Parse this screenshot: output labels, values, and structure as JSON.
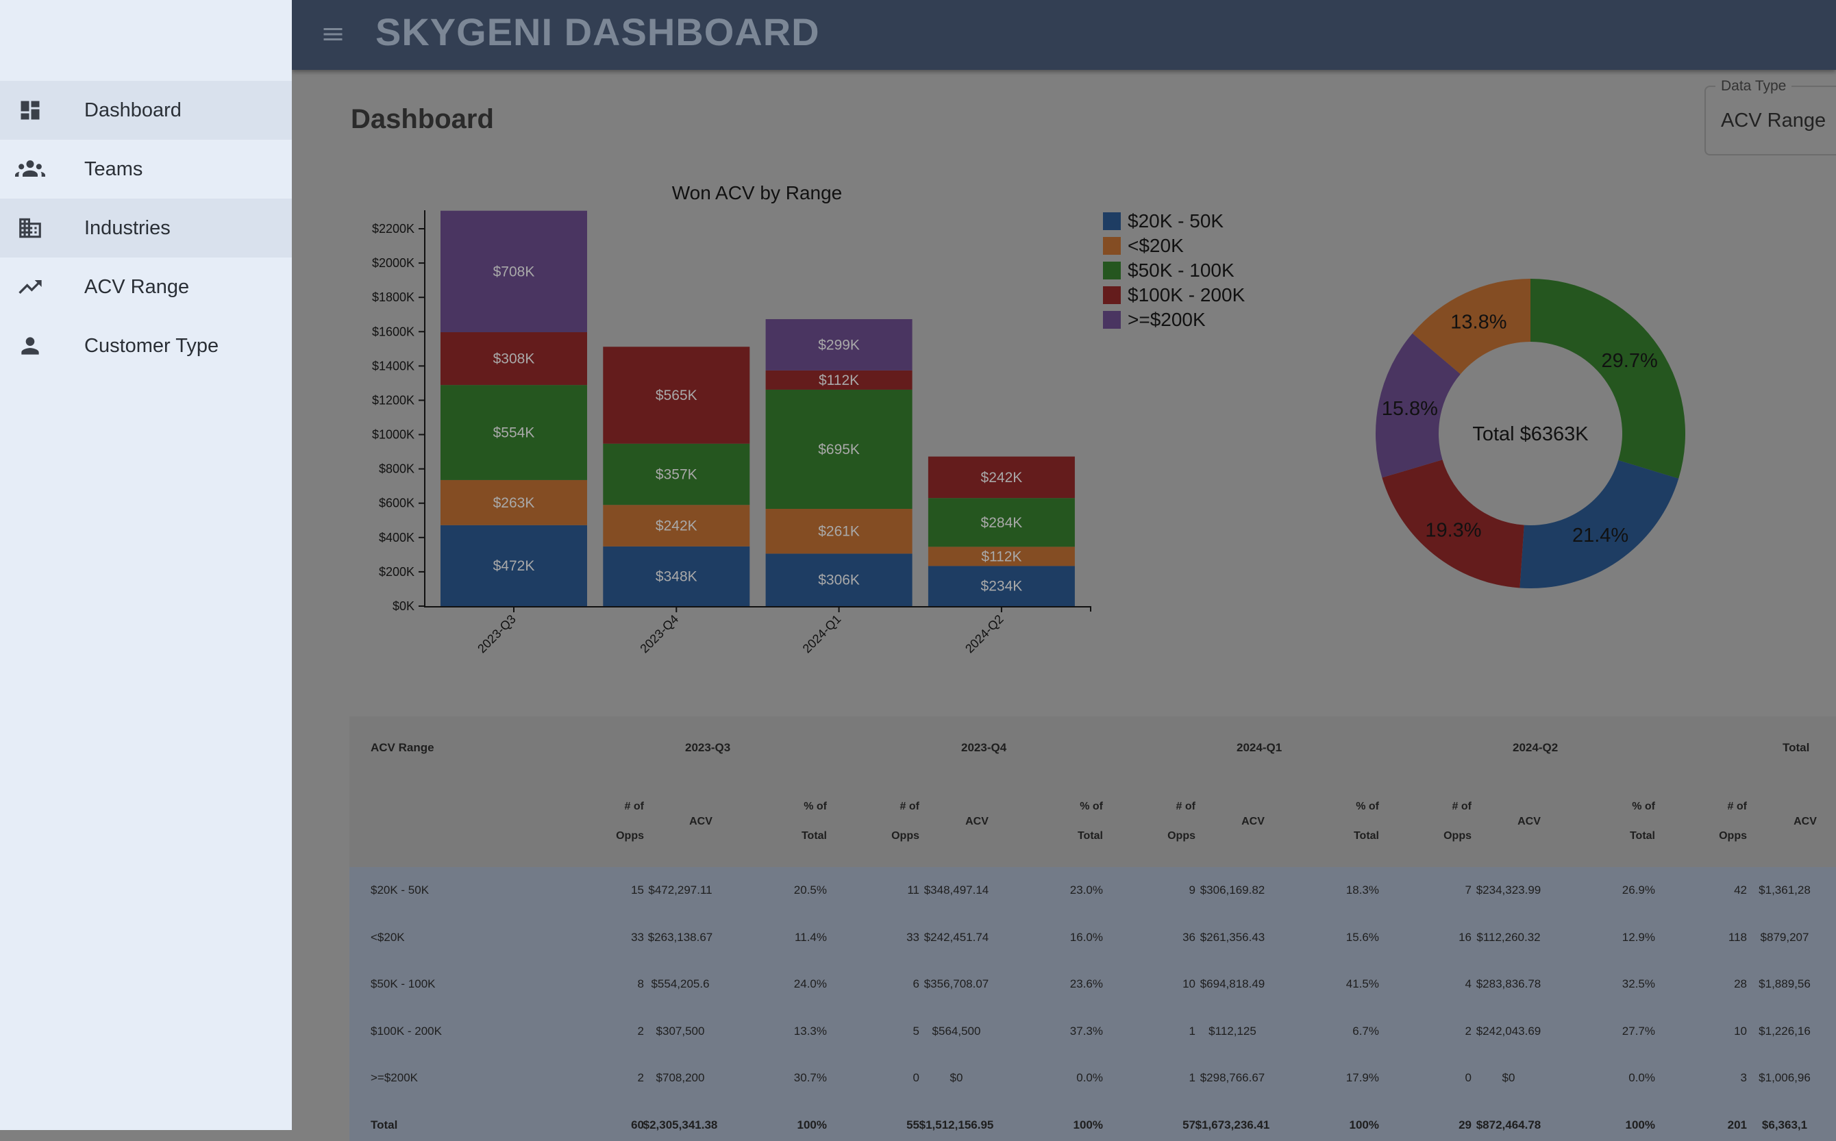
{
  "app": {
    "title": "SKYGENI DASHBOARD"
  },
  "sidebar": {
    "items": [
      {
        "label": "Dashboard",
        "icon": "dashboard-icon"
      },
      {
        "label": "Teams",
        "icon": "groups-icon"
      },
      {
        "label": "Industries",
        "icon": "building-icon"
      },
      {
        "label": "ACV Range",
        "icon": "trending-up-icon"
      },
      {
        "label": "Customer Type",
        "icon": "person-icon"
      }
    ]
  },
  "page": {
    "title": "Dashboard"
  },
  "data_type": {
    "label": "Data Type",
    "value": "ACV Range"
  },
  "colors": {
    "20k_50k": "#1e3d63",
    "lt20k": "#844d23",
    "50k_100k": "#25561f",
    "100k_200k": "#641c1c",
    "gte200k": "#4a3561"
  },
  "chart_data": [
    {
      "type": "bar",
      "stacked": true,
      "title": "Won ACV by Range",
      "categories": [
        "2023-Q3",
        "2023-Q4",
        "2024-Q1",
        "2024-Q2"
      ],
      "ylim": [
        0,
        2200
      ],
      "yticks": [
        "$0K",
        "$200K",
        "$400K",
        "$600K",
        "$800K",
        "$1000K",
        "$1200K",
        "$1400K",
        "$1600K",
        "$1800K",
        "$2000K",
        "$2200K"
      ],
      "legend_position": "top-right",
      "series": [
        {
          "name": "$20K - 50K",
          "color": "#1e3d63",
          "values": [
            472,
            348,
            306,
            234
          ],
          "labels": [
            "$472K",
            "$348K",
            "$306K",
            "$234K"
          ]
        },
        {
          "name": "<$20K",
          "color": "#844d23",
          "values": [
            263,
            242,
            261,
            112
          ],
          "labels": [
            "$263K",
            "$242K",
            "$261K",
            "$112K"
          ]
        },
        {
          "name": "$50K - 100K",
          "color": "#25561f",
          "values": [
            554,
            357,
            695,
            284
          ],
          "labels": [
            "$554K",
            "$357K",
            "$695K",
            "$284K"
          ]
        },
        {
          "name": "$100K - 200K",
          "color": "#641c1c",
          "values": [
            308,
            565,
            112,
            242
          ],
          "labels": [
            "$308K",
            "$565K",
            "$112K",
            "$242K"
          ]
        },
        {
          "name": ">=$200K",
          "color": "#4a3561",
          "values": [
            708,
            0,
            299,
            0
          ],
          "labels": [
            "$708K",
            "",
            "$299K",
            ""
          ]
        }
      ]
    },
    {
      "type": "pie",
      "donut": true,
      "center_label": "Total $6363K",
      "slices": [
        {
          "color": "#25561f",
          "value": 29.7,
          "label": "29.7%"
        },
        {
          "color": "#1e3d63",
          "value": 21.4,
          "label": "21.4%"
        },
        {
          "color": "#641c1c",
          "value": 19.3,
          "label": "19.3%"
        },
        {
          "color": "#4a3561",
          "value": 15.8,
          "label": "15.8%"
        },
        {
          "color": "#844d23",
          "value": 13.8,
          "label": "13.8%"
        }
      ]
    }
  ],
  "table": {
    "range_header": "ACV Range",
    "periods": [
      "2023-Q3",
      "2023-Q4",
      "2024-Q1",
      "2024-Q2",
      "Total"
    ],
    "sub_opps": [
      "# of",
      "Opps"
    ],
    "sub_acv": "ACV",
    "sub_pct": [
      "% of",
      "Total"
    ],
    "rows": [
      {
        "label": "$20K - 50K",
        "cells": [
          "15",
          "$472,297.11",
          "20.5%",
          "11",
          "$348,497.14",
          "23.0%",
          "9",
          "$306,169.82",
          "18.3%",
          "7",
          "$234,323.99",
          "26.9%",
          "42",
          "$1,361,28"
        ]
      },
      {
        "label": "<$20K",
        "cells": [
          "33",
          "$263,138.67",
          "11.4%",
          "33",
          "$242,451.74",
          "16.0%",
          "36",
          "$261,356.43",
          "15.6%",
          "16",
          "$112,260.32",
          "12.9%",
          "118",
          "$879,207"
        ]
      },
      {
        "label": "$50K - 100K",
        "cells": [
          "8",
          "$554,205.6",
          "24.0%",
          "6",
          "$356,708.07",
          "23.6%",
          "10",
          "$694,818.49",
          "41.5%",
          "4",
          "$283,836.78",
          "32.5%",
          "28",
          "$1,889,56"
        ]
      },
      {
        "label": "$100K - 200K",
        "cells": [
          "2",
          "$307,500",
          "13.3%",
          "5",
          "$564,500",
          "37.3%",
          "1",
          "$112,125",
          "6.7%",
          "2",
          "$242,043.69",
          "27.7%",
          "10",
          "$1,226,16"
        ]
      },
      {
        "label": ">=$200K",
        "cells": [
          "2",
          "$708,200",
          "30.7%",
          "0",
          "$0",
          "0.0%",
          "1",
          "$298,766.67",
          "17.9%",
          "0",
          "$0",
          "0.0%",
          "3",
          "$1,006,96"
        ]
      },
      {
        "label": "Total",
        "cells": [
          "60",
          "$2,305,341.38",
          "100%",
          "55",
          "$1,512,156.95",
          "100%",
          "57",
          "$1,673,236.41",
          "100%",
          "29",
          "$872,464.78",
          "100%",
          "201",
          "$6,363,1"
        ]
      }
    ]
  }
}
